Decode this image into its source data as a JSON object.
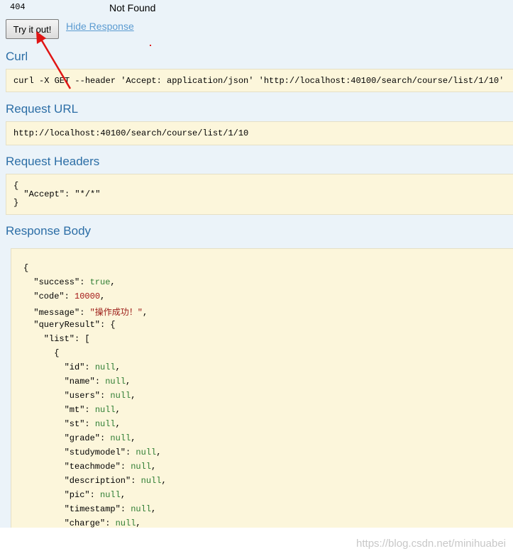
{
  "status": {
    "code": "404",
    "text": "Not Found"
  },
  "try_button_label": "Try it out!",
  "hide_response_label": "Hide Response",
  "curl": {
    "title": "Curl",
    "command": "curl -X GET --header 'Accept: application/json' 'http://localhost:40100/search/course/list/1/10'"
  },
  "request_url": {
    "title": "Request URL",
    "value": "http://localhost:40100/search/course/list/1/10"
  },
  "request_headers": {
    "title": "Request Headers",
    "lines": [
      "{",
      "  \"Accept\": \"*/*\"",
      "}"
    ]
  },
  "response_body": {
    "title": "Response Body",
    "lines": [
      {
        "indent": 0,
        "key": "",
        "value": "{",
        "type": "punct"
      },
      {
        "indent": 1,
        "key": "\"success\"",
        "value": "true",
        "type": "lit"
      },
      {
        "indent": 1,
        "key": "\"code\"",
        "value": "10000",
        "type": "num"
      },
      {
        "indent": 1,
        "key": "\"message\"",
        "value": "\"操作成功！\"",
        "type": "str"
      },
      {
        "indent": 1,
        "key": "\"queryResult\"",
        "value": "{",
        "type": "punct"
      },
      {
        "indent": 2,
        "key": "\"list\"",
        "value": "[",
        "type": "punct"
      },
      {
        "indent": 3,
        "key": "",
        "value": "{",
        "type": "punct"
      },
      {
        "indent": 4,
        "key": "\"id\"",
        "value": "null",
        "type": "lit"
      },
      {
        "indent": 4,
        "key": "\"name\"",
        "value": "null",
        "type": "lit"
      },
      {
        "indent": 4,
        "key": "\"users\"",
        "value": "null",
        "type": "lit"
      },
      {
        "indent": 4,
        "key": "\"mt\"",
        "value": "null",
        "type": "lit"
      },
      {
        "indent": 4,
        "key": "\"st\"",
        "value": "null",
        "type": "lit"
      },
      {
        "indent": 4,
        "key": "\"grade\"",
        "value": "null",
        "type": "lit"
      },
      {
        "indent": 4,
        "key": "\"studymodel\"",
        "value": "null",
        "type": "lit"
      },
      {
        "indent": 4,
        "key": "\"teachmode\"",
        "value": "null",
        "type": "lit"
      },
      {
        "indent": 4,
        "key": "\"description\"",
        "value": "null",
        "type": "lit"
      },
      {
        "indent": 4,
        "key": "\"pic\"",
        "value": "null",
        "type": "lit"
      },
      {
        "indent": 4,
        "key": "\"timestamp\"",
        "value": "null",
        "type": "lit"
      },
      {
        "indent": 4,
        "key": "\"charge\"",
        "value": "null",
        "type": "lit"
      }
    ]
  },
  "watermark": "https://blog.csdn.net/minihuabei"
}
